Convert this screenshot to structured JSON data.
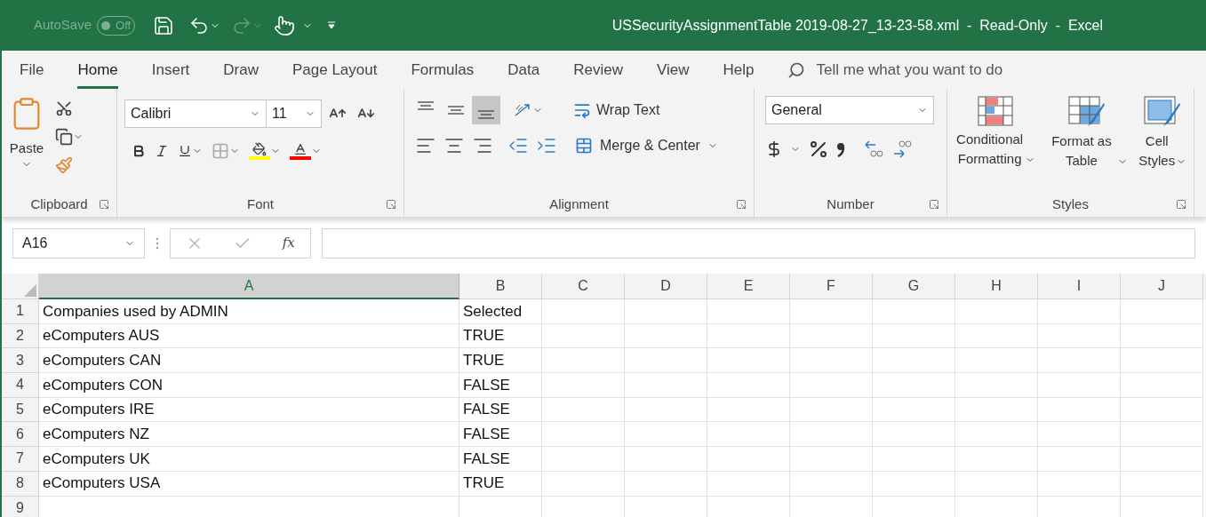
{
  "title_bar": {
    "autosave_label": "AutoSave",
    "autosave_state": "Off",
    "autosave_on": false,
    "title": "USSecurityAssignmentTable 2019-08-27_13-23-58.xml  -  Read-Only  -  Excel"
  },
  "tabs": [
    {
      "label": "File",
      "selected": false
    },
    {
      "label": "Home",
      "selected": true
    },
    {
      "label": "Insert",
      "selected": false
    },
    {
      "label": "Draw",
      "selected": false
    },
    {
      "label": "Page Layout",
      "selected": false
    },
    {
      "label": "Formulas",
      "selected": false
    },
    {
      "label": "Data",
      "selected": false
    },
    {
      "label": "Review",
      "selected": false
    },
    {
      "label": "View",
      "selected": false
    },
    {
      "label": "Help",
      "selected": false
    }
  ],
  "search": {
    "placeholder": "Tell me what you want to do"
  },
  "ribbon": {
    "clipboard": {
      "label": "Clipboard",
      "paste": "Paste"
    },
    "font": {
      "label": "Font",
      "font_name": "Calibri",
      "font_size": "11"
    },
    "alignment": {
      "label": "Alignment",
      "wrap_text": "Wrap Text",
      "merge": "Merge & Center",
      "vertical": [
        {
          "selected": false
        },
        {
          "selected": false
        },
        {
          "selected": true
        }
      ]
    },
    "number": {
      "label": "Number",
      "format": "General"
    },
    "styles": {
      "label": "Styles",
      "buttons": [
        {
          "label": "Conditional Formatting",
          "kind": "conditional"
        },
        {
          "label": "Format as Table",
          "kind": "table"
        },
        {
          "label": "Cell Styles",
          "kind": "cell"
        }
      ]
    }
  },
  "formula_bar": {
    "name_box": "A16",
    "function_label": "fx"
  },
  "columns": [
    {
      "label": "A",
      "selected": true
    },
    {
      "label": "B",
      "selected": false
    },
    {
      "label": "C",
      "selected": false
    },
    {
      "label": "D",
      "selected": false
    },
    {
      "label": "E",
      "selected": false
    },
    {
      "label": "F",
      "selected": false
    },
    {
      "label": "G",
      "selected": false
    },
    {
      "label": "H",
      "selected": false
    },
    {
      "label": "I",
      "selected": false
    },
    {
      "label": "J",
      "selected": false
    }
  ],
  "rows": [
    {
      "number": "1",
      "cells": [
        "Companies used by ADMIN",
        "Selected"
      ]
    },
    {
      "number": "2",
      "cells": [
        "eComputers AUS",
        "TRUE"
      ]
    },
    {
      "number": "3",
      "cells": [
        "eComputers CAN",
        "TRUE"
      ]
    },
    {
      "number": "4",
      "cells": [
        "eComputers CON",
        "FALSE"
      ]
    },
    {
      "number": "5",
      "cells": [
        "eComputers IRE",
        "FALSE"
      ]
    },
    {
      "number": "6",
      "cells": [
        "eComputers NZ",
        "FALSE"
      ]
    },
    {
      "number": "7",
      "cells": [
        "eComputers UK",
        "FALSE"
      ]
    },
    {
      "number": "8",
      "cells": [
        "eComputers USA",
        "TRUE"
      ]
    },
    {
      "number": "9",
      "cells": []
    }
  ]
}
